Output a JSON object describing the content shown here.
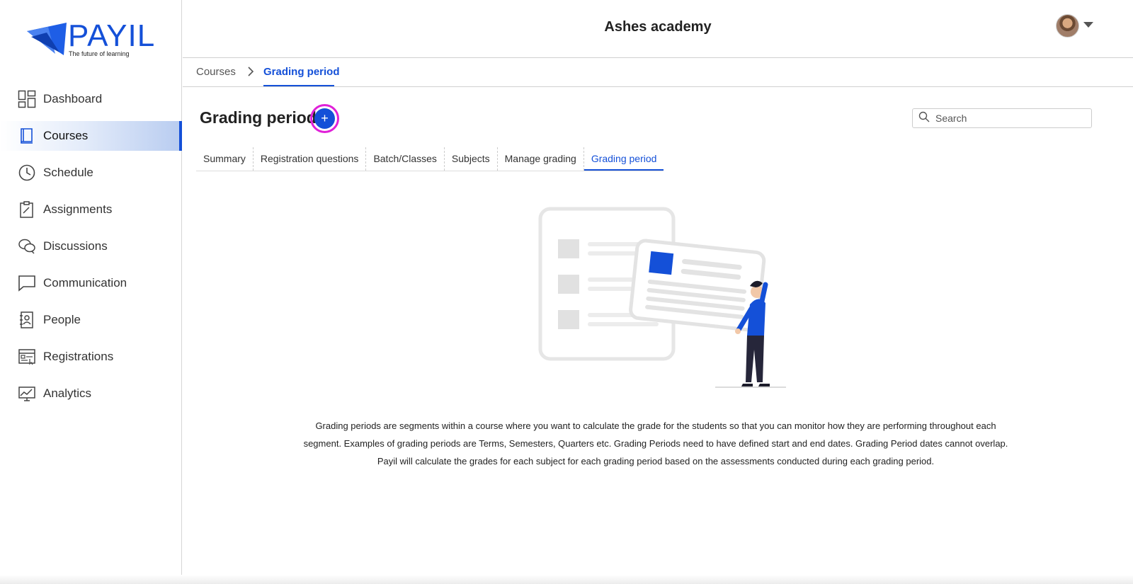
{
  "brand": {
    "name": "PAYIL",
    "tagline": "The future of learning",
    "accent_color": "#1450d8"
  },
  "header": {
    "org_title": "Ashes academy",
    "avatar_icon": "user-avatar",
    "caret_icon": "caret-down-icon"
  },
  "sidebar": {
    "items": [
      {
        "label": "Dashboard",
        "icon": "dashboard-icon",
        "active": false
      },
      {
        "label": "Courses",
        "icon": "book-icon",
        "active": true
      },
      {
        "label": "Schedule",
        "icon": "clock-icon",
        "active": false
      },
      {
        "label": "Assignments",
        "icon": "clipboard-icon",
        "active": false
      },
      {
        "label": "Discussions",
        "icon": "chat-bubbles-icon",
        "active": false
      },
      {
        "label": "Communication",
        "icon": "message-icon",
        "active": false
      },
      {
        "label": "People",
        "icon": "contact-book-icon",
        "active": false
      },
      {
        "label": "Registrations",
        "icon": "registration-form-icon",
        "active": false
      },
      {
        "label": "Analytics",
        "icon": "analytics-icon",
        "active": false
      }
    ]
  },
  "breadcrumb": {
    "parent": "Courses",
    "separator": ">",
    "current": "Grading period"
  },
  "page": {
    "title": "Grading period",
    "add_button_label": "+"
  },
  "search": {
    "placeholder": "Search",
    "value": ""
  },
  "tabs": [
    {
      "label": "Summary",
      "active": false
    },
    {
      "label": "Registration questions",
      "active": false
    },
    {
      "label": "Batch/Classes",
      "active": false
    },
    {
      "label": "Subjects",
      "active": false
    },
    {
      "label": "Manage grading",
      "active": false
    },
    {
      "label": "Grading period",
      "active": true
    }
  ],
  "empty_state": {
    "illustration_icon": "person-holding-card-illustration",
    "description": "Grading periods are segments within a course where you want to calculate the grade for the students so that you can monitor how they are performing throughout each segment. Examples of grading periods are Terms, Semesters, Quarters etc. Grading Periods need to have defined start and end dates. Grading Period dates cannot overlap. Payil will calculate the grades for each subject for each grading period based on the assessments conducted during each grading period."
  },
  "colors": {
    "highlight_ring": "#e020d8",
    "illustration_gray": "#e3e3e3"
  }
}
